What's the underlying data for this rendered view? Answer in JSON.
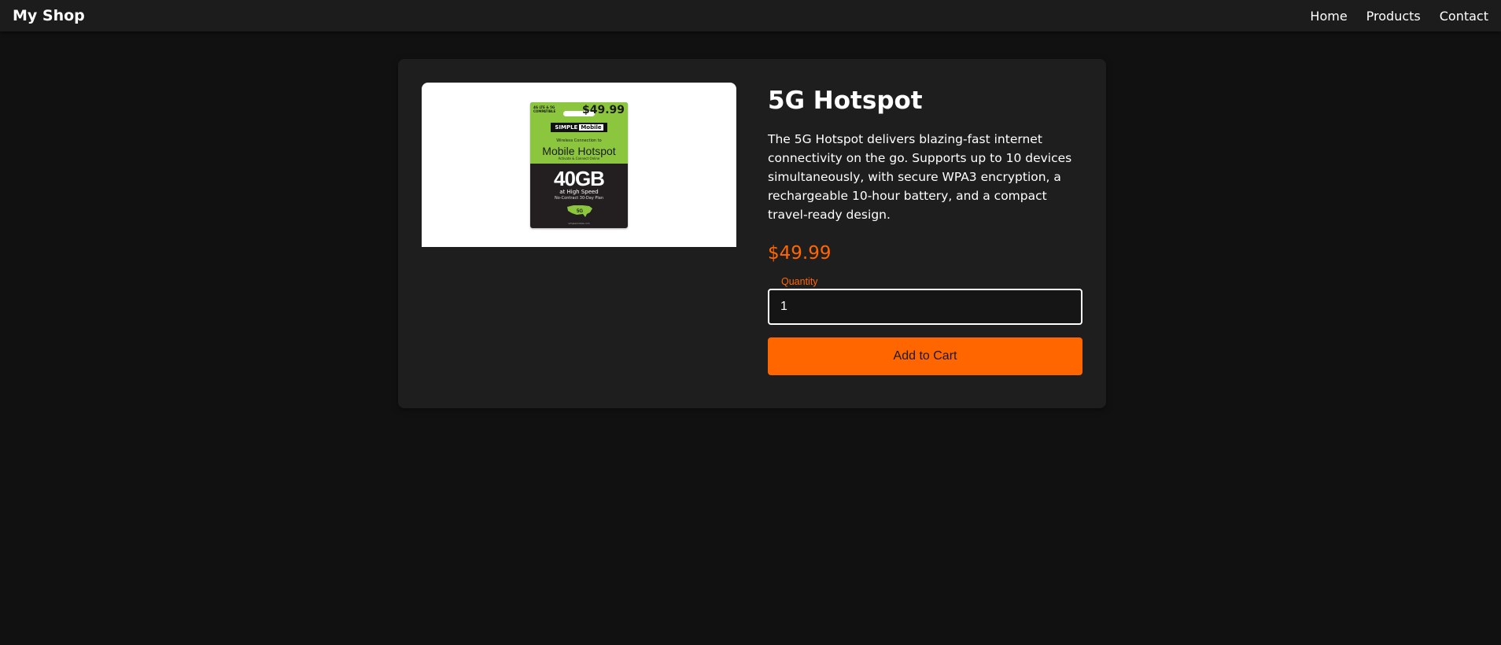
{
  "header": {
    "brand": "My Shop",
    "nav": [
      {
        "label": "Home"
      },
      {
        "label": "Products"
      },
      {
        "label": "Contact"
      }
    ]
  },
  "product": {
    "title": "5G Hotspot",
    "description": "The 5G Hotspot delivers blazing-fast internet connectivity on the go. Supports up to 10 devices simultaneously, with secure WPA3 encryption, a rechargeable 10-hour battery, and a compact travel-ready design.",
    "price": "$49.99",
    "quantity_label": "Quantity",
    "quantity_value": "1",
    "add_to_cart_label": "Add to Cart",
    "image": {
      "compat": "4G LTE & 5G COMPATIBLE",
      "price": "$49.99",
      "brand_simple": "SIMPLE",
      "brand_mobile": "Mobile",
      "tagline": "Wireless Connection to",
      "name": "Mobile Hotspot",
      "subline": "Activate & Connect Online",
      "data": "40GB",
      "speed": "at High Speed",
      "plan": "No-Contract 30-Day Plan",
      "network": "5G",
      "fine_print": "simplemobile.com"
    }
  },
  "colors": {
    "accent": "#ff6600",
    "background": "#111111",
    "card": "#1e1e1e",
    "package_green": "#8cc63f"
  }
}
